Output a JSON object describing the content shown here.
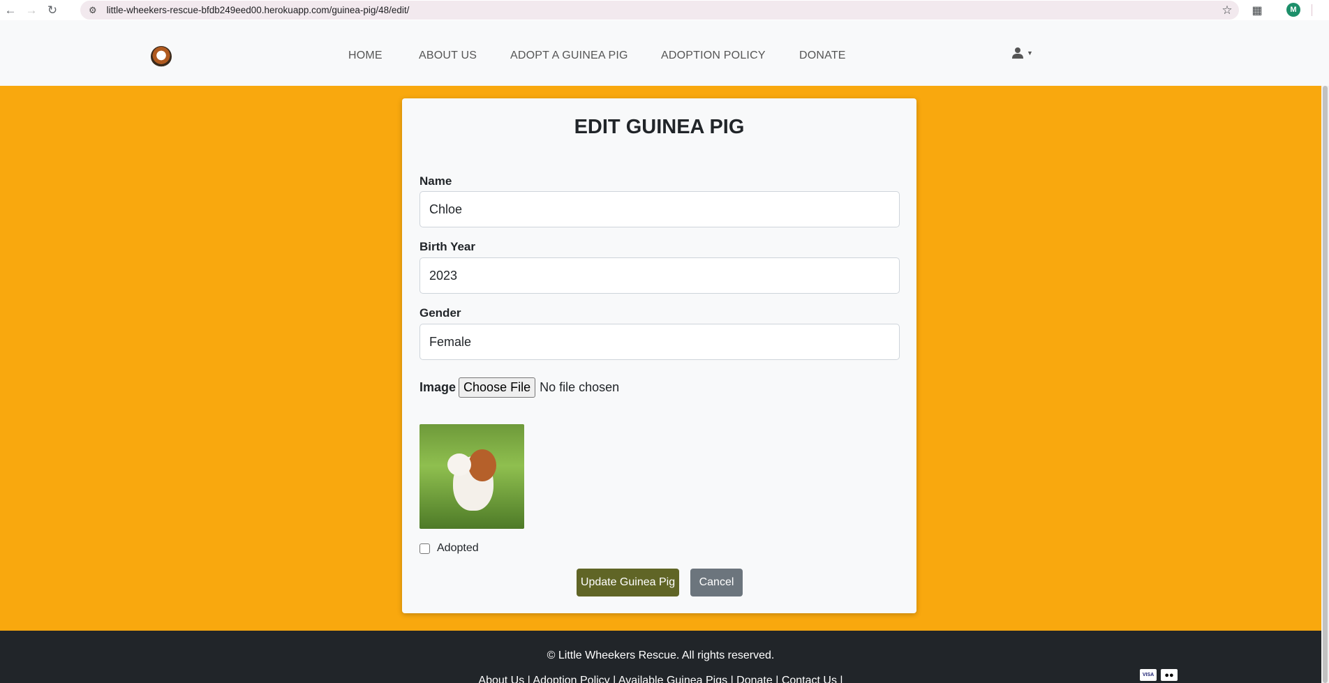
{
  "browser": {
    "url": "little-wheekers-rescue-bfdb249eed00.herokuapp.com/guinea-pig/48/edit/",
    "profile_initial": "M"
  },
  "nav": {
    "links": [
      "HOME",
      "ABOUT US",
      "ADOPT A GUINEA PIG",
      "ADOPTION POLICY",
      "DONATE"
    ]
  },
  "form": {
    "title": "EDIT GUINEA PIG",
    "name_label": "Name",
    "name_value": "Chloe",
    "birth_year_label": "Birth Year",
    "birth_year_value": "2023",
    "gender_label": "Gender",
    "gender_value": "Female",
    "image_label": "Image",
    "choose_file_label": "Choose File",
    "no_file_text": "No file chosen",
    "adopted_label": "Adopted",
    "adopted_checked": false,
    "update_button": "Update Guinea Pig",
    "cancel_button": "Cancel"
  },
  "footer": {
    "copyright": "© Little Wheekers Rescue. All rights reserved.",
    "links": [
      "About Us",
      "Adoption Policy",
      "Available Guinea Pigs",
      "Donate",
      "Contact Us"
    ],
    "payment_icons": [
      "VISA",
      "●●"
    ]
  },
  "colors": {
    "background": "#f9a80e",
    "update_button": "#606526",
    "cancel_button": "#6c757d",
    "footer": "#212529"
  }
}
